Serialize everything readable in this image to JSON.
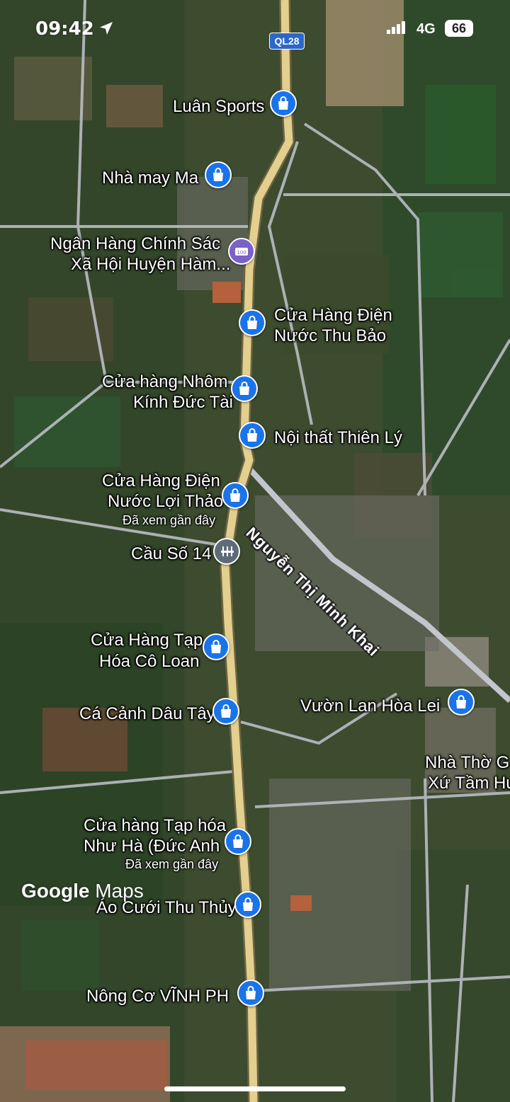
{
  "status_bar": {
    "time": "09:42",
    "network": "4G",
    "battery": "66"
  },
  "route_shield": "QL28",
  "street_label": "Nguyễn Thị Minh Khai",
  "google_logo": {
    "brand": "Google",
    "product": "Maps"
  },
  "pois": [
    {
      "name": "Luân Sports",
      "icon": "shopping-bag-icon",
      "pin_color": "blue"
    },
    {
      "name": "Nhà may Ma",
      "icon": "shopping-bag-icon",
      "pin_color": "blue"
    },
    {
      "name_line1": "Ngân Hàng Chính Sác",
      "name_line2": "Xã Hội Huyện Hàm...",
      "icon": "atm-icon",
      "pin_color": "purple"
    },
    {
      "name_line1": "Cửa Hàng Điện",
      "name_line2": "Nước Thu Bảo",
      "icon": "shopping-bag-icon",
      "pin_color": "blue"
    },
    {
      "name_line1": "Cửa hàng Nhôm",
      "name_line2": "Kính Đức Tài",
      "icon": "shopping-bag-icon",
      "pin_color": "blue"
    },
    {
      "name": "Nội thất Thiên Lý",
      "icon": "shopping-bag-icon",
      "pin_color": "blue"
    },
    {
      "name_line1": "Cửa Hàng Điện",
      "name_line2": "Nước Lợi Thảo",
      "note": "Đã xem gần đây",
      "icon": "shopping-bag-icon",
      "pin_color": "blue"
    },
    {
      "name": "Cầu Số 14",
      "icon": "bridge-icon",
      "pin_color": "gray"
    },
    {
      "name_line1": "Cửa Hàng Tạp",
      "name_line2": "Hóa Cô Loan",
      "icon": "shopping-bag-icon",
      "pin_color": "blue"
    },
    {
      "name": "Cá Cảnh Dâu Tây",
      "icon": "shopping-bag-icon",
      "pin_color": "blue"
    },
    {
      "name": "Vườn Lan Hòa Lei",
      "icon": "shopping-bag-icon",
      "pin_color": "blue"
    },
    {
      "name_line1": "Nhà Thờ G",
      "name_line2": "Xứ Tầm Hư"
    },
    {
      "name_line1": "Cửa hàng Tạp hóa",
      "name_line2": "Như Hà (Đức Anh",
      "note": "Đã xem gần đây",
      "icon": "shopping-bag-icon",
      "pin_color": "blue"
    },
    {
      "name": "Áo Cưới Thu Thủy",
      "icon": "shopping-bag-icon",
      "pin_color": "blue"
    },
    {
      "name": "Nông Cơ VĨNH PH",
      "icon": "shopping-bag-icon",
      "pin_color": "blue"
    }
  ]
}
